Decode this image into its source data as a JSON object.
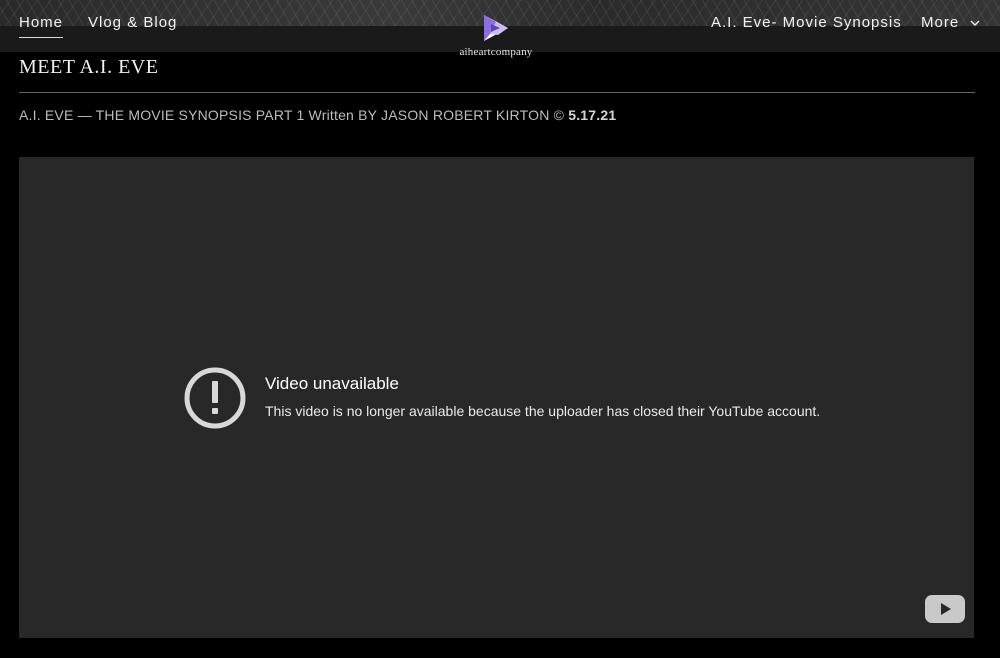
{
  "nav": {
    "home": "Home",
    "vlog": "Vlog & Blog",
    "synopsis": "A.I. Eve- Movie Synopsis",
    "more": "More"
  },
  "logo": {
    "text": "aiheartcompany"
  },
  "page": {
    "title": "MEET A.I. EVE",
    "subtitle_main": "A.I. EVE — THE MOVIE SYNOPSIS PART 1 Written BY JASON ROBERT KIRTON ©",
    "subtitle_date": "5.17.21"
  },
  "video": {
    "title": "Video unavailable",
    "message": "This video is no longer available because the uploader has closed their YouTube account."
  },
  "colors": {
    "background": "#000000",
    "player": "#282828",
    "logo_accent": "#8b6fe0"
  },
  "icons": [
    "chevron-down-icon",
    "alert-icon",
    "youtube-play-icon"
  ]
}
